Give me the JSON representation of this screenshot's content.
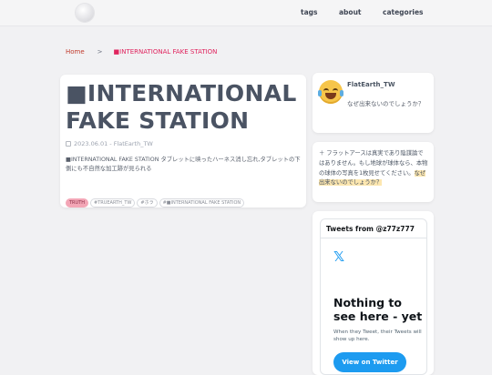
{
  "header": {
    "logo": "globe-logo",
    "nav": [
      {
        "label": "tags"
      },
      {
        "label": "about"
      },
      {
        "label": "categories"
      }
    ]
  },
  "breadcrumb": {
    "home": "Home",
    "separator": ">",
    "current": "■INTERNATIONAL FAKE STATION"
  },
  "post": {
    "title": "■INTERNATIONAL FAKE STATION",
    "date": "2023.06.01",
    "meta_sep": " - ",
    "author": "FlatEarth_TW",
    "excerpt": "■INTERNATIONAL FAKE STATION タブレットに映ったハーネス消し忘れ,タブレットの下側にも不自然な加工跡が見られる",
    "tags": [
      "TRUTH",
      "#TRUEARTH_TW",
      "#ホラ",
      "#■INTERNATIONAL FAKE STATION"
    ]
  },
  "profile": {
    "avatar_icon": "laughing-tears-emoji",
    "name": "FlatEarth_TW",
    "bio": "なぜ出来ないのでしょうか？"
  },
  "note": {
    "text": "＋ フラットアースは真実であり陰謀論ではありません。もし地球が球体なら、本物の球体の写真を1枚見せてください。",
    "highlight": "なぜ出来ないのでしょうか？"
  },
  "twitter": {
    "from": "Tweets from @z77z777",
    "logo": "x-logo",
    "empty_title": "Nothing to see here - yet",
    "empty_sub": "When they Tweet, their Tweets will show up here.",
    "button": "View on Twitter"
  },
  "colors": {
    "accent_pink": "#e0245e",
    "twitter_blue": "#1d9bf0",
    "highlight": "#fde7b0",
    "background": "#f1f1f3"
  }
}
